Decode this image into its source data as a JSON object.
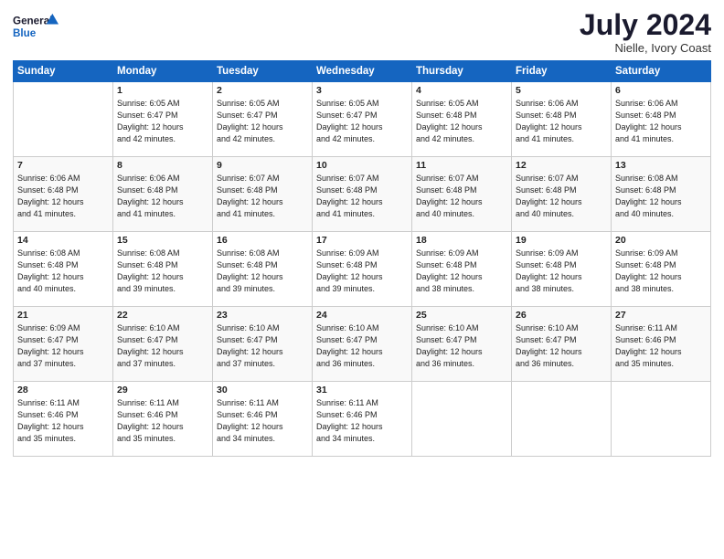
{
  "logo": {
    "line1": "General",
    "line2": "Blue"
  },
  "title": "July 2024",
  "location": "Nielle, Ivory Coast",
  "days_header": [
    "Sunday",
    "Monday",
    "Tuesday",
    "Wednesday",
    "Thursday",
    "Friday",
    "Saturday"
  ],
  "weeks": [
    [
      {
        "num": "",
        "sunrise": "",
        "sunset": "",
        "daylight": ""
      },
      {
        "num": "1",
        "sunrise": "Sunrise: 6:05 AM",
        "sunset": "Sunset: 6:47 PM",
        "daylight": "Daylight: 12 hours and 42 minutes."
      },
      {
        "num": "2",
        "sunrise": "Sunrise: 6:05 AM",
        "sunset": "Sunset: 6:47 PM",
        "daylight": "Daylight: 12 hours and 42 minutes."
      },
      {
        "num": "3",
        "sunrise": "Sunrise: 6:05 AM",
        "sunset": "Sunset: 6:47 PM",
        "daylight": "Daylight: 12 hours and 42 minutes."
      },
      {
        "num": "4",
        "sunrise": "Sunrise: 6:05 AM",
        "sunset": "Sunset: 6:48 PM",
        "daylight": "Daylight: 12 hours and 42 minutes."
      },
      {
        "num": "5",
        "sunrise": "Sunrise: 6:06 AM",
        "sunset": "Sunset: 6:48 PM",
        "daylight": "Daylight: 12 hours and 41 minutes."
      },
      {
        "num": "6",
        "sunrise": "Sunrise: 6:06 AM",
        "sunset": "Sunset: 6:48 PM",
        "daylight": "Daylight: 12 hours and 41 minutes."
      }
    ],
    [
      {
        "num": "7",
        "sunrise": "Sunrise: 6:06 AM",
        "sunset": "Sunset: 6:48 PM",
        "daylight": "Daylight: 12 hours and 41 minutes."
      },
      {
        "num": "8",
        "sunrise": "Sunrise: 6:06 AM",
        "sunset": "Sunset: 6:48 PM",
        "daylight": "Daylight: 12 hours and 41 minutes."
      },
      {
        "num": "9",
        "sunrise": "Sunrise: 6:07 AM",
        "sunset": "Sunset: 6:48 PM",
        "daylight": "Daylight: 12 hours and 41 minutes."
      },
      {
        "num": "10",
        "sunrise": "Sunrise: 6:07 AM",
        "sunset": "Sunset: 6:48 PM",
        "daylight": "Daylight: 12 hours and 41 minutes."
      },
      {
        "num": "11",
        "sunrise": "Sunrise: 6:07 AM",
        "sunset": "Sunset: 6:48 PM",
        "daylight": "Daylight: 12 hours and 40 minutes."
      },
      {
        "num": "12",
        "sunrise": "Sunrise: 6:07 AM",
        "sunset": "Sunset: 6:48 PM",
        "daylight": "Daylight: 12 hours and 40 minutes."
      },
      {
        "num": "13",
        "sunrise": "Sunrise: 6:08 AM",
        "sunset": "Sunset: 6:48 PM",
        "daylight": "Daylight: 12 hours and 40 minutes."
      }
    ],
    [
      {
        "num": "14",
        "sunrise": "Sunrise: 6:08 AM",
        "sunset": "Sunset: 6:48 PM",
        "daylight": "Daylight: 12 hours and 40 minutes."
      },
      {
        "num": "15",
        "sunrise": "Sunrise: 6:08 AM",
        "sunset": "Sunset: 6:48 PM",
        "daylight": "Daylight: 12 hours and 39 minutes."
      },
      {
        "num": "16",
        "sunrise": "Sunrise: 6:08 AM",
        "sunset": "Sunset: 6:48 PM",
        "daylight": "Daylight: 12 hours and 39 minutes."
      },
      {
        "num": "17",
        "sunrise": "Sunrise: 6:09 AM",
        "sunset": "Sunset: 6:48 PM",
        "daylight": "Daylight: 12 hours and 39 minutes."
      },
      {
        "num": "18",
        "sunrise": "Sunrise: 6:09 AM",
        "sunset": "Sunset: 6:48 PM",
        "daylight": "Daylight: 12 hours and 38 minutes."
      },
      {
        "num": "19",
        "sunrise": "Sunrise: 6:09 AM",
        "sunset": "Sunset: 6:48 PM",
        "daylight": "Daylight: 12 hours and 38 minutes."
      },
      {
        "num": "20",
        "sunrise": "Sunrise: 6:09 AM",
        "sunset": "Sunset: 6:48 PM",
        "daylight": "Daylight: 12 hours and 38 minutes."
      }
    ],
    [
      {
        "num": "21",
        "sunrise": "Sunrise: 6:09 AM",
        "sunset": "Sunset: 6:47 PM",
        "daylight": "Daylight: 12 hours and 37 minutes."
      },
      {
        "num": "22",
        "sunrise": "Sunrise: 6:10 AM",
        "sunset": "Sunset: 6:47 PM",
        "daylight": "Daylight: 12 hours and 37 minutes."
      },
      {
        "num": "23",
        "sunrise": "Sunrise: 6:10 AM",
        "sunset": "Sunset: 6:47 PM",
        "daylight": "Daylight: 12 hours and 37 minutes."
      },
      {
        "num": "24",
        "sunrise": "Sunrise: 6:10 AM",
        "sunset": "Sunset: 6:47 PM",
        "daylight": "Daylight: 12 hours and 36 minutes."
      },
      {
        "num": "25",
        "sunrise": "Sunrise: 6:10 AM",
        "sunset": "Sunset: 6:47 PM",
        "daylight": "Daylight: 12 hours and 36 minutes."
      },
      {
        "num": "26",
        "sunrise": "Sunrise: 6:10 AM",
        "sunset": "Sunset: 6:47 PM",
        "daylight": "Daylight: 12 hours and 36 minutes."
      },
      {
        "num": "27",
        "sunrise": "Sunrise: 6:11 AM",
        "sunset": "Sunset: 6:46 PM",
        "daylight": "Daylight: 12 hours and 35 minutes."
      }
    ],
    [
      {
        "num": "28",
        "sunrise": "Sunrise: 6:11 AM",
        "sunset": "Sunset: 6:46 PM",
        "daylight": "Daylight: 12 hours and 35 minutes."
      },
      {
        "num": "29",
        "sunrise": "Sunrise: 6:11 AM",
        "sunset": "Sunset: 6:46 PM",
        "daylight": "Daylight: 12 hours and 35 minutes."
      },
      {
        "num": "30",
        "sunrise": "Sunrise: 6:11 AM",
        "sunset": "Sunset: 6:46 PM",
        "daylight": "Daylight: 12 hours and 34 minutes."
      },
      {
        "num": "31",
        "sunrise": "Sunrise: 6:11 AM",
        "sunset": "Sunset: 6:46 PM",
        "daylight": "Daylight: 12 hours and 34 minutes."
      },
      {
        "num": "",
        "sunrise": "",
        "sunset": "",
        "daylight": ""
      },
      {
        "num": "",
        "sunrise": "",
        "sunset": "",
        "daylight": ""
      },
      {
        "num": "",
        "sunrise": "",
        "sunset": "",
        "daylight": ""
      }
    ]
  ]
}
